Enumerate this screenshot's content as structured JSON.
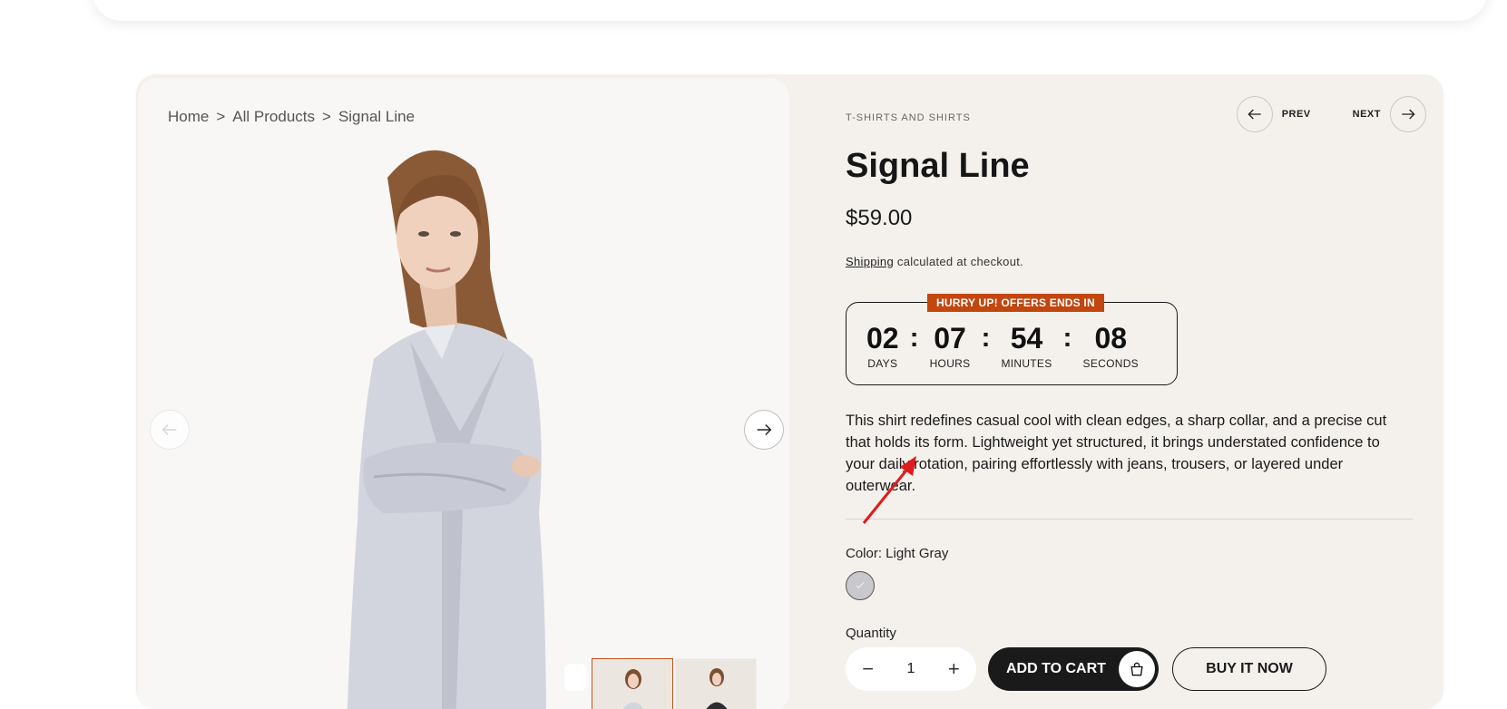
{
  "breadcrumb": {
    "home": "Home",
    "sep": ">",
    "all_products": "All Products",
    "current": "Signal Line"
  },
  "product": {
    "category": "T-SHIRTS AND SHIRTS",
    "title": "Signal Line",
    "price": "$59.00",
    "shipping_link": "Shipping",
    "shipping_note": "calculated at checkout.",
    "description": "This shirt redefines casual cool with clean edges, a sharp collar, and a precise cut that holds its form. Lightweight yet structured, it brings understated confidence to your daily rotation, pairing effortlessly with jeans, trousers, or layered under outerwear.",
    "color_label": "Color: Light Gray",
    "swatch_color": "#c9c9cd",
    "quantity_label": "Quantity",
    "quantity": "1"
  },
  "pager": {
    "prev": "PREV",
    "next": "NEXT"
  },
  "countdown": {
    "banner": "HURRY UP! OFFERS ENDS IN",
    "days": "02",
    "days_label": "DAYS",
    "hours": "07",
    "hours_label": "HOURS",
    "minutes": "54",
    "minutes_label": "MINUTES",
    "seconds": "08",
    "seconds_label": "SECONDS",
    "accent": "#c3460f"
  },
  "actions": {
    "add_to_cart": "ADD TO CART",
    "buy_now": "BUY IT NOW"
  }
}
